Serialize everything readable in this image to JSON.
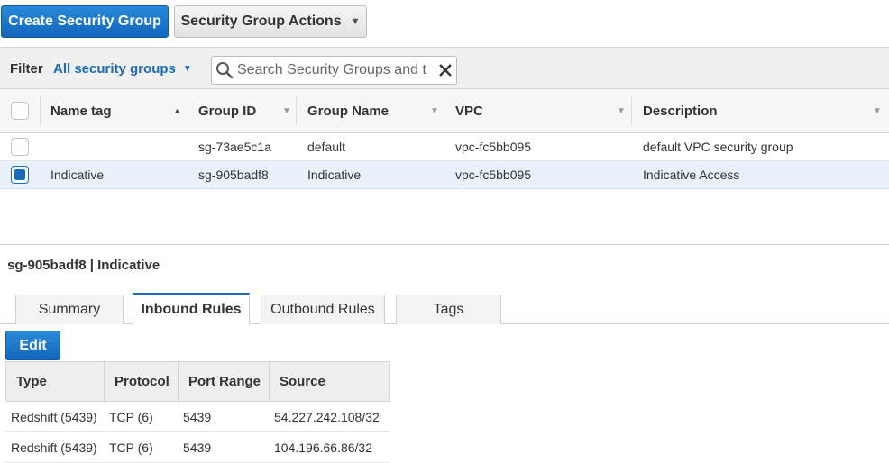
{
  "toolbar": {
    "create_label": "Create Security Group",
    "actions_label": "Security Group Actions"
  },
  "filter": {
    "label": "Filter",
    "selected": "All security groups",
    "search_placeholder": "Search Security Groups and t"
  },
  "table": {
    "headers": {
      "name_tag": "Name tag",
      "group_id": "Group ID",
      "group_name": "Group Name",
      "vpc": "VPC",
      "description": "Description"
    },
    "rows": [
      {
        "name_tag": "",
        "group_id": "sg-73ae5c1a",
        "group_name": "default",
        "vpc": "vpc-fc5bb095",
        "description": "default VPC security group",
        "selected": false
      },
      {
        "name_tag": "Indicative",
        "group_id": "sg-905badf8",
        "group_name": "Indicative",
        "vpc": "vpc-fc5bb095",
        "description": "Indicative Access",
        "selected": true
      }
    ]
  },
  "detail": {
    "title": "sg-905badf8 | Indicative",
    "tabs": [
      {
        "label": "Summary",
        "active": false
      },
      {
        "label": "Inbound Rules",
        "active": true
      },
      {
        "label": "Outbound Rules",
        "active": false
      },
      {
        "label": "Tags",
        "active": false
      }
    ],
    "edit_label": "Edit",
    "rules": {
      "headers": {
        "type": "Type",
        "protocol": "Protocol",
        "port_range": "Port Range",
        "source": "Source"
      },
      "rows": [
        {
          "type": "Redshift (5439)",
          "protocol": "TCP (6)",
          "port_range": "5439",
          "source": "54.227.242.108/32"
        },
        {
          "type": "Redshift (5439)",
          "protocol": "TCP (6)",
          "port_range": "5439",
          "source": "104.196.66.86/32"
        }
      ]
    }
  },
  "colors": {
    "accent": "#1a6bb8",
    "primary_button": "#1a73c8"
  },
  "icons": {
    "search": "search-icon",
    "clear": "close-icon",
    "dropdown": "chevron-down-icon"
  }
}
